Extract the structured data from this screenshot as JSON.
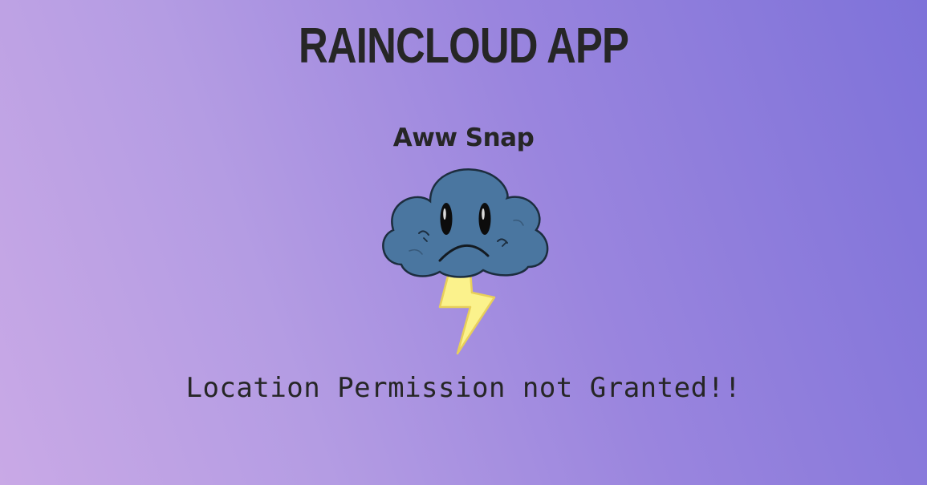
{
  "app": {
    "title": "RAINCLOUD APP"
  },
  "error": {
    "heading": "Aww Snap",
    "message": "Location Permission not Granted!!",
    "illustration": "sad-storm-cloud-icon"
  },
  "colors": {
    "background_start": "#c9a9e6",
    "background_end": "#7e72d9",
    "text": "#262626",
    "cloud": "#4a76a0",
    "lightning": "#fbf28c"
  }
}
